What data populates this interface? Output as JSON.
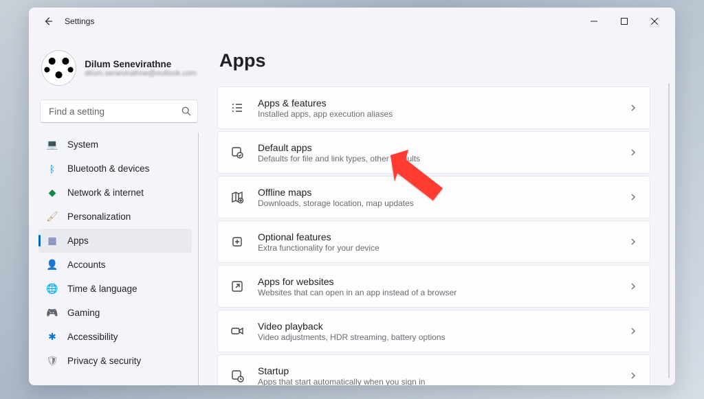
{
  "titlebar": {
    "title": "Settings"
  },
  "profile": {
    "name": "Dilum Senevirathne",
    "email": "dilum.senevirathne@outlook.com"
  },
  "search": {
    "placeholder": "Find a setting"
  },
  "nav": [
    {
      "id": "system",
      "label": "System",
      "icon": "💻",
      "icon_color": "#0078d4"
    },
    {
      "id": "bluetooth",
      "label": "Bluetooth & devices",
      "icon": "ᛒ",
      "icon_color": "#0078d4"
    },
    {
      "id": "network",
      "label": "Network & internet",
      "icon": "◆",
      "icon_color": "#10893e"
    },
    {
      "id": "personalization",
      "label": "Personalization",
      "icon": "🖌",
      "icon_color": "#c29b66"
    },
    {
      "id": "apps",
      "label": "Apps",
      "icon": "▦",
      "icon_color": "#5a6aa8",
      "active": true
    },
    {
      "id": "accounts",
      "label": "Accounts",
      "icon": "👤",
      "icon_color": "#6fa35e"
    },
    {
      "id": "time",
      "label": "Time & language",
      "icon": "🌐",
      "icon_color": "#4a8ec5"
    },
    {
      "id": "gaming",
      "label": "Gaming",
      "icon": "🎮",
      "icon_color": "#888"
    },
    {
      "id": "accessibility",
      "label": "Accessibility",
      "icon": "✱",
      "icon_color": "#0078d4"
    },
    {
      "id": "privacy",
      "label": "Privacy & security",
      "icon": "🛡",
      "icon_color": "#888"
    }
  ],
  "page": {
    "title": "Apps"
  },
  "settings": [
    {
      "id": "apps-features",
      "title": "Apps & features",
      "sub": "Installed apps, app execution aliases",
      "icon": "list"
    },
    {
      "id": "default-apps",
      "title": "Default apps",
      "sub": "Defaults for file and link types, other defaults",
      "icon": "default"
    },
    {
      "id": "offline-maps",
      "title": "Offline maps",
      "sub": "Downloads, storage location, map updates",
      "icon": "map"
    },
    {
      "id": "optional-features",
      "title": "Optional features",
      "sub": "Extra functionality for your device",
      "icon": "plus"
    },
    {
      "id": "apps-websites",
      "title": "Apps for websites",
      "sub": "Websites that can open in an app instead of a browser",
      "icon": "open"
    },
    {
      "id": "video-playback",
      "title": "Video playback",
      "sub": "Video adjustments, HDR streaming, battery options",
      "icon": "video"
    },
    {
      "id": "startup",
      "title": "Startup",
      "sub": "Apps that start automatically when you sign in",
      "icon": "startup"
    }
  ]
}
